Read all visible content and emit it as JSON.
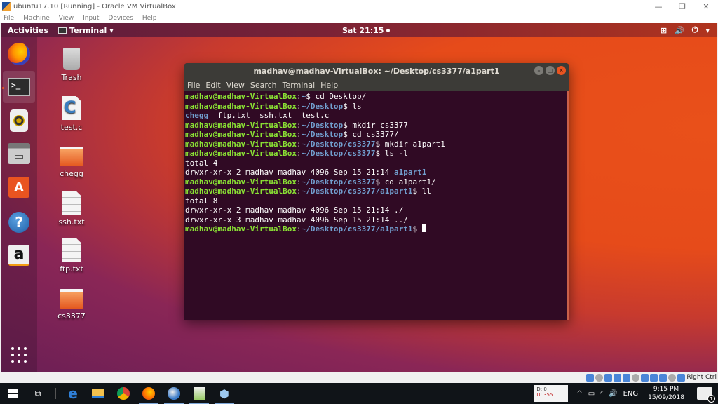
{
  "host_window": {
    "title": "ubuntu17.10 [Running] - Oracle VM VirtualBox",
    "menu": [
      "File",
      "Machine",
      "View",
      "Input",
      "Devices",
      "Help"
    ],
    "controls": {
      "minimize": "—",
      "maximize": "❐",
      "close": "✕"
    }
  },
  "topbar": {
    "activities": "Activities",
    "app_menu": "Terminal",
    "app_menu_arrow": "▾",
    "clock": "Sat 21:15",
    "tray": {
      "network": "⊞",
      "volume": "🔊",
      "power": "⏻",
      "arrow": "▾"
    }
  },
  "dock": {
    "items": [
      {
        "name": "Firefox"
      },
      {
        "name": "Terminal",
        "glyph": ">_"
      },
      {
        "name": "Rhythmbox"
      },
      {
        "name": "Files"
      },
      {
        "name": "Ubuntu Software",
        "glyph": "A"
      },
      {
        "name": "Help",
        "glyph": "?"
      },
      {
        "name": "Amazon",
        "glyph": "a"
      }
    ]
  },
  "desktop_icons": [
    {
      "label": "Trash",
      "type": "trash"
    },
    {
      "label": "test.c",
      "type": "c-source"
    },
    {
      "label": "chegg",
      "type": "folder"
    },
    {
      "label": "ssh.txt",
      "type": "text"
    },
    {
      "label": "ftp.txt",
      "type": "text"
    },
    {
      "label": "cs3377",
      "type": "folder"
    }
  ],
  "terminal": {
    "title": "madhav@madhav-VirtualBox: ~/Desktop/cs3377/a1part1",
    "menu": [
      "File",
      "Edit",
      "View",
      "Search",
      "Terminal",
      "Help"
    ],
    "user_host": "madhav@madhav-VirtualBox",
    "lines": [
      {
        "kind": "prompt",
        "path": "~",
        "cmd": "cd Desktop/"
      },
      {
        "kind": "prompt",
        "path": "~/Desktop",
        "cmd": "ls"
      },
      {
        "kind": "ls",
        "dir": "chegg",
        "rest": "  ftp.txt  ssh.txt  test.c"
      },
      {
        "kind": "prompt",
        "path": "~/Desktop",
        "cmd": "mkdir cs3377"
      },
      {
        "kind": "prompt",
        "path": "~/Desktop",
        "cmd": "cd cs3377/"
      },
      {
        "kind": "prompt",
        "path": "~/Desktop/cs3377",
        "cmd": "mkdir a1part1"
      },
      {
        "kind": "prompt",
        "path": "~/Desktop/cs3377",
        "cmd": "ls -l"
      },
      {
        "kind": "out",
        "text": "total 4"
      },
      {
        "kind": "lsl",
        "text": "drwxr-xr-x 2 madhav madhav 4096 Sep 15 21:14 ",
        "dir": "a1part1"
      },
      {
        "kind": "prompt",
        "path": "~/Desktop/cs3377",
        "cmd": "cd a1part1/"
      },
      {
        "kind": "prompt",
        "path": "~/Desktop/cs3377/a1part1",
        "cmd": "ll"
      },
      {
        "kind": "out",
        "text": "total 8"
      },
      {
        "kind": "out",
        "text": "drwxr-xr-x 2 madhav madhav 4096 Sep 15 21:14 ./"
      },
      {
        "kind": "out",
        "text": "drwxr-xr-x 3 madhav madhav 4096 Sep 15 21:14 ../"
      },
      {
        "kind": "prompt",
        "path": "~/Desktop/cs3377/a1part1",
        "cmd": "",
        "cursor": true
      }
    ]
  },
  "vb_status": {
    "host_key": "Right Ctrl"
  },
  "taskbar": {
    "apps": [
      "Start",
      "Task View",
      "Edge",
      "File Explorer",
      "Chrome",
      "Firefox",
      "Thunderbird",
      "Notepad++",
      "VirtualBox"
    ],
    "netmon": {
      "down": "D: 0",
      "up": "U: 355"
    },
    "lang": "ENG",
    "time": "9:15 PM",
    "date": "15/09/2018",
    "notifications": "1"
  },
  "colors": {
    "terminal_bg": "#300a24",
    "prompt_user": "#8ae234",
    "prompt_path": "#729fcf",
    "ubuntu_orange": "#e95420"
  }
}
